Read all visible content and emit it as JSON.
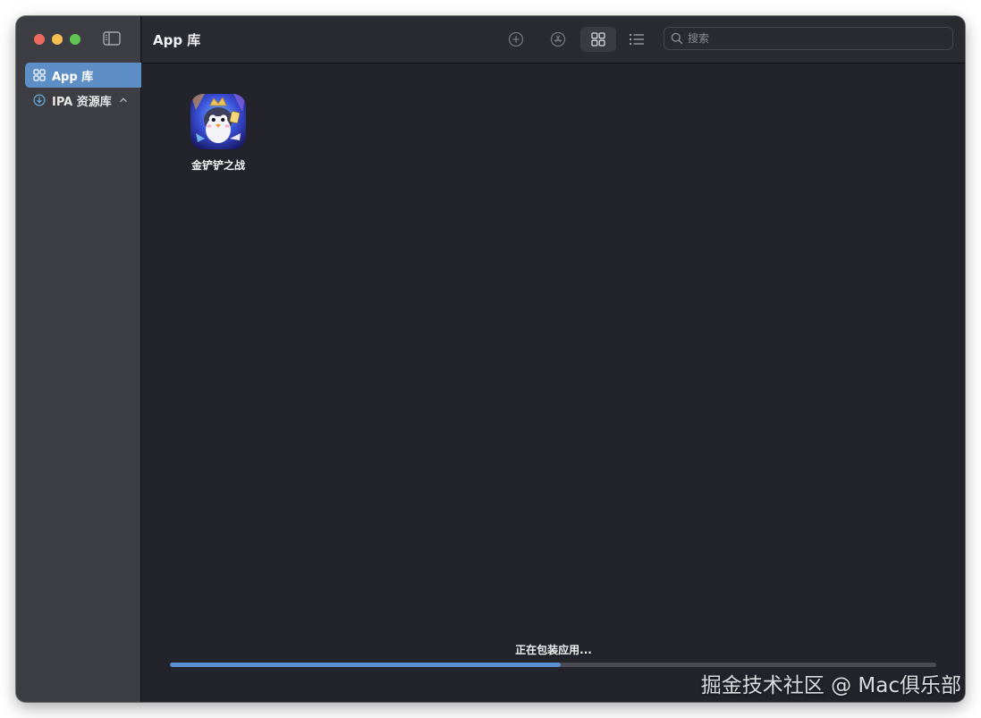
{
  "window": {
    "title": "App 库"
  },
  "sidebar": {
    "items": [
      {
        "label": "App 库",
        "icon": "grid-icon",
        "selected": true
      },
      {
        "label": "IPA 资源库",
        "icon": "download-circle-icon",
        "selected": false,
        "expanded": true
      }
    ]
  },
  "toolbar": {
    "buttons": [
      {
        "name": "add-button",
        "icon": "plus-circle-icon"
      },
      {
        "name": "install-button",
        "icon": "app-store-icon"
      },
      {
        "name": "grid-view-button",
        "icon": "grid-view-icon",
        "active": true
      },
      {
        "name": "list-view-button",
        "icon": "list-view-icon",
        "active": false
      }
    ],
    "search_placeholder": "搜索"
  },
  "apps": [
    {
      "name": "金铲铲之战",
      "icon": "game-app-icon"
    }
  ],
  "status": {
    "text": "正在包装应用...",
    "progress": 0.51
  },
  "watermark": "掘金技术社区 @ Mac俱乐部",
  "colors": {
    "accent": "#5d8ec6",
    "progress": "#5b8ed0",
    "background": "#22232b",
    "sidebar": "#3c3e43"
  }
}
